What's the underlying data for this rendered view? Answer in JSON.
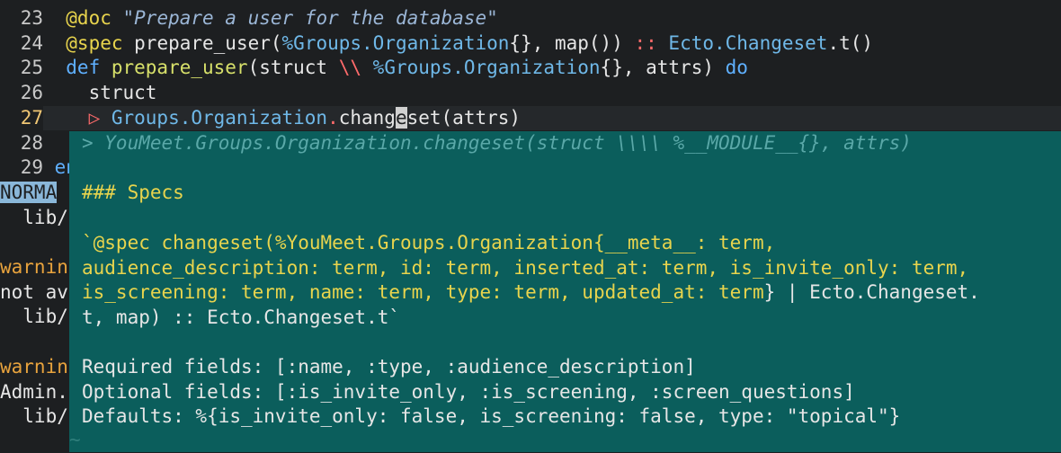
{
  "editor": {
    "lines": [
      {
        "num": "23",
        "parts": [
          [
            "attr",
            "  @doc "
          ],
          [
            "str",
            "\"Prepare a user for the database\""
          ]
        ]
      },
      {
        "num": "24",
        "parts": [
          [
            "attr",
            "  @spec "
          ],
          [
            "dim",
            "prepare_user("
          ],
          [
            "mod",
            "%Groups.Organization"
          ],
          [
            "dim",
            "{}, map()) "
          ],
          [
            "op",
            ":: "
          ],
          [
            "mod",
            "Ecto.Changeset"
          ],
          [
            "dim",
            ".t()"
          ]
        ]
      },
      {
        "num": "25",
        "parts": [
          [
            "kw",
            "  def "
          ],
          [
            "fn",
            "prepare_user"
          ],
          [
            "dim",
            "(struct "
          ],
          [
            "op",
            "\\\\ "
          ],
          [
            "mod",
            "%Groups.Organization"
          ],
          [
            "dim",
            "{}, attrs) "
          ],
          [
            "kw",
            "do"
          ]
        ]
      },
      {
        "num": "26",
        "parts": [
          [
            "dim",
            "    struct"
          ]
        ]
      },
      {
        "num": "27",
        "parts": [
          [
            "op",
            "    ▷ "
          ],
          [
            "mod",
            "Groups.Organization"
          ],
          [
            "dot",
            "."
          ],
          [
            "dim",
            "chang"
          ],
          [
            "cur",
            "e"
          ],
          [
            "dim",
            "set(attrs)"
          ]
        ]
      }
    ],
    "after_lines": [
      {
        "num": "28",
        "text": ""
      },
      {
        "num": "29",
        "text": " en"
      }
    ],
    "left_column": [
      {
        "text": "NORMA",
        "style": "mode"
      },
      {
        "text": "  lib/",
        "style": "dim"
      },
      {
        "text": "",
        "style": "dim"
      },
      {
        "text": "warnin",
        "style": "warn"
      },
      {
        "text": "not av",
        "style": "dim"
      },
      {
        "text": "  lib/",
        "style": "dim"
      },
      {
        "text": "",
        "style": "dim"
      },
      {
        "text": "warnin",
        "style": "warn"
      },
      {
        "text": "Admin.",
        "style": "dim"
      },
      {
        "text": "  lib/",
        "style": "dim"
      }
    ]
  },
  "popup": {
    "signature": "> YouMeet.Groups.Organization.changeset(struct \\\\\\\\ %__MODULE__{}, attrs)",
    "header": "### Specs",
    "spec_lines": [
      [
        [
          "spec",
          "`@spec changeset(%YouMeet.Groups.Organization{__meta__: term,"
        ]
      ],
      [
        [
          "spec",
          "audience_description: term, id: term, inserted_at: term, is_invite_only: term,"
        ]
      ],
      [
        [
          "spec",
          "is_screening: term, name: term, type: term, updated_at: term"
        ],
        [
          "ptxt",
          "} | Ecto.Changeset."
        ]
      ],
      [
        [
          "ptxt",
          "t, map) :: Ecto.Changeset.t`"
        ]
      ]
    ],
    "fields": [
      "Required fields: [:name, :type, :audience_description]",
      "Optional fields: [:is_invite_only, :is_screening, :screen_questions]",
      "Defaults: %{is_invite_only: false, is_screening: false, type: \"topical\"}"
    ],
    "tilde": "~"
  }
}
